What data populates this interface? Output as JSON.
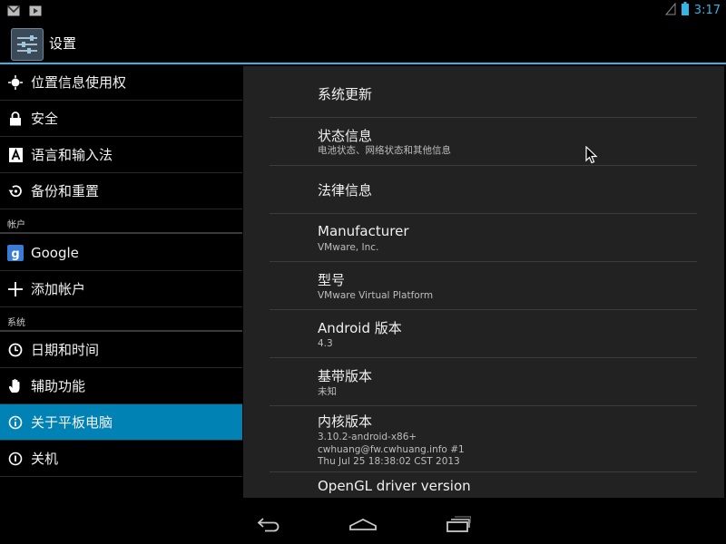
{
  "status_bar": {
    "time": "3:17",
    "left_icons": [
      "gmail-icon",
      "media-play-icon"
    ],
    "right_icons": [
      "signal-empty-icon",
      "battery-icon"
    ],
    "accent_color": "#33b5e5"
  },
  "action_bar": {
    "title": "设置",
    "icon": "settings-sliders-icon"
  },
  "sidebar": {
    "items_top": [
      {
        "label": "位置信息使用权",
        "icon": "location-icon"
      },
      {
        "label": "安全",
        "icon": "lock-icon"
      },
      {
        "label": "语言和输入法",
        "icon": "keyboard-a-icon"
      },
      {
        "label": "备份和重置",
        "icon": "backup-restore-icon"
      }
    ],
    "section_accounts": "帐户",
    "items_accounts": [
      {
        "label": "Google",
        "icon": "google-icon"
      },
      {
        "label": "添加帐户",
        "icon": "plus-icon"
      }
    ],
    "section_system": "系统",
    "items_system": [
      {
        "label": "日期和时间",
        "icon": "clock-icon"
      },
      {
        "label": "辅助功能",
        "icon": "hand-icon"
      },
      {
        "label": "关于平板电脑",
        "icon": "info-icon",
        "selected": true
      },
      {
        "label": "关机",
        "icon": "power-icon"
      }
    ],
    "selected_color": "#0082b4"
  },
  "detail": {
    "rows": [
      {
        "title": "系统更新",
        "sub": []
      },
      {
        "title": "状态信息",
        "sub": [
          "电池状态、网络状态和其他信息"
        ]
      },
      {
        "title": "法律信息",
        "sub": []
      },
      {
        "title": "Manufacturer",
        "sub": [
          "VMware, Inc."
        ]
      },
      {
        "title": "型号",
        "sub": [
          "VMware Virtual Platform"
        ]
      },
      {
        "title": "Android 版本",
        "sub": [
          "4.3"
        ]
      },
      {
        "title": "基带版本",
        "sub": [
          "未知"
        ]
      },
      {
        "title": "内核版本",
        "sub": [
          "3.10.2-android-x86+",
          "cwhuang@fw.cwhuang.info #1",
          "Thu Jul 25 18:38:02 CST 2013"
        ]
      },
      {
        "title": "OpenGL driver version",
        "sub": []
      }
    ]
  },
  "nav_bar": {
    "buttons": [
      "back-icon",
      "home-icon",
      "recent-apps-icon"
    ]
  }
}
